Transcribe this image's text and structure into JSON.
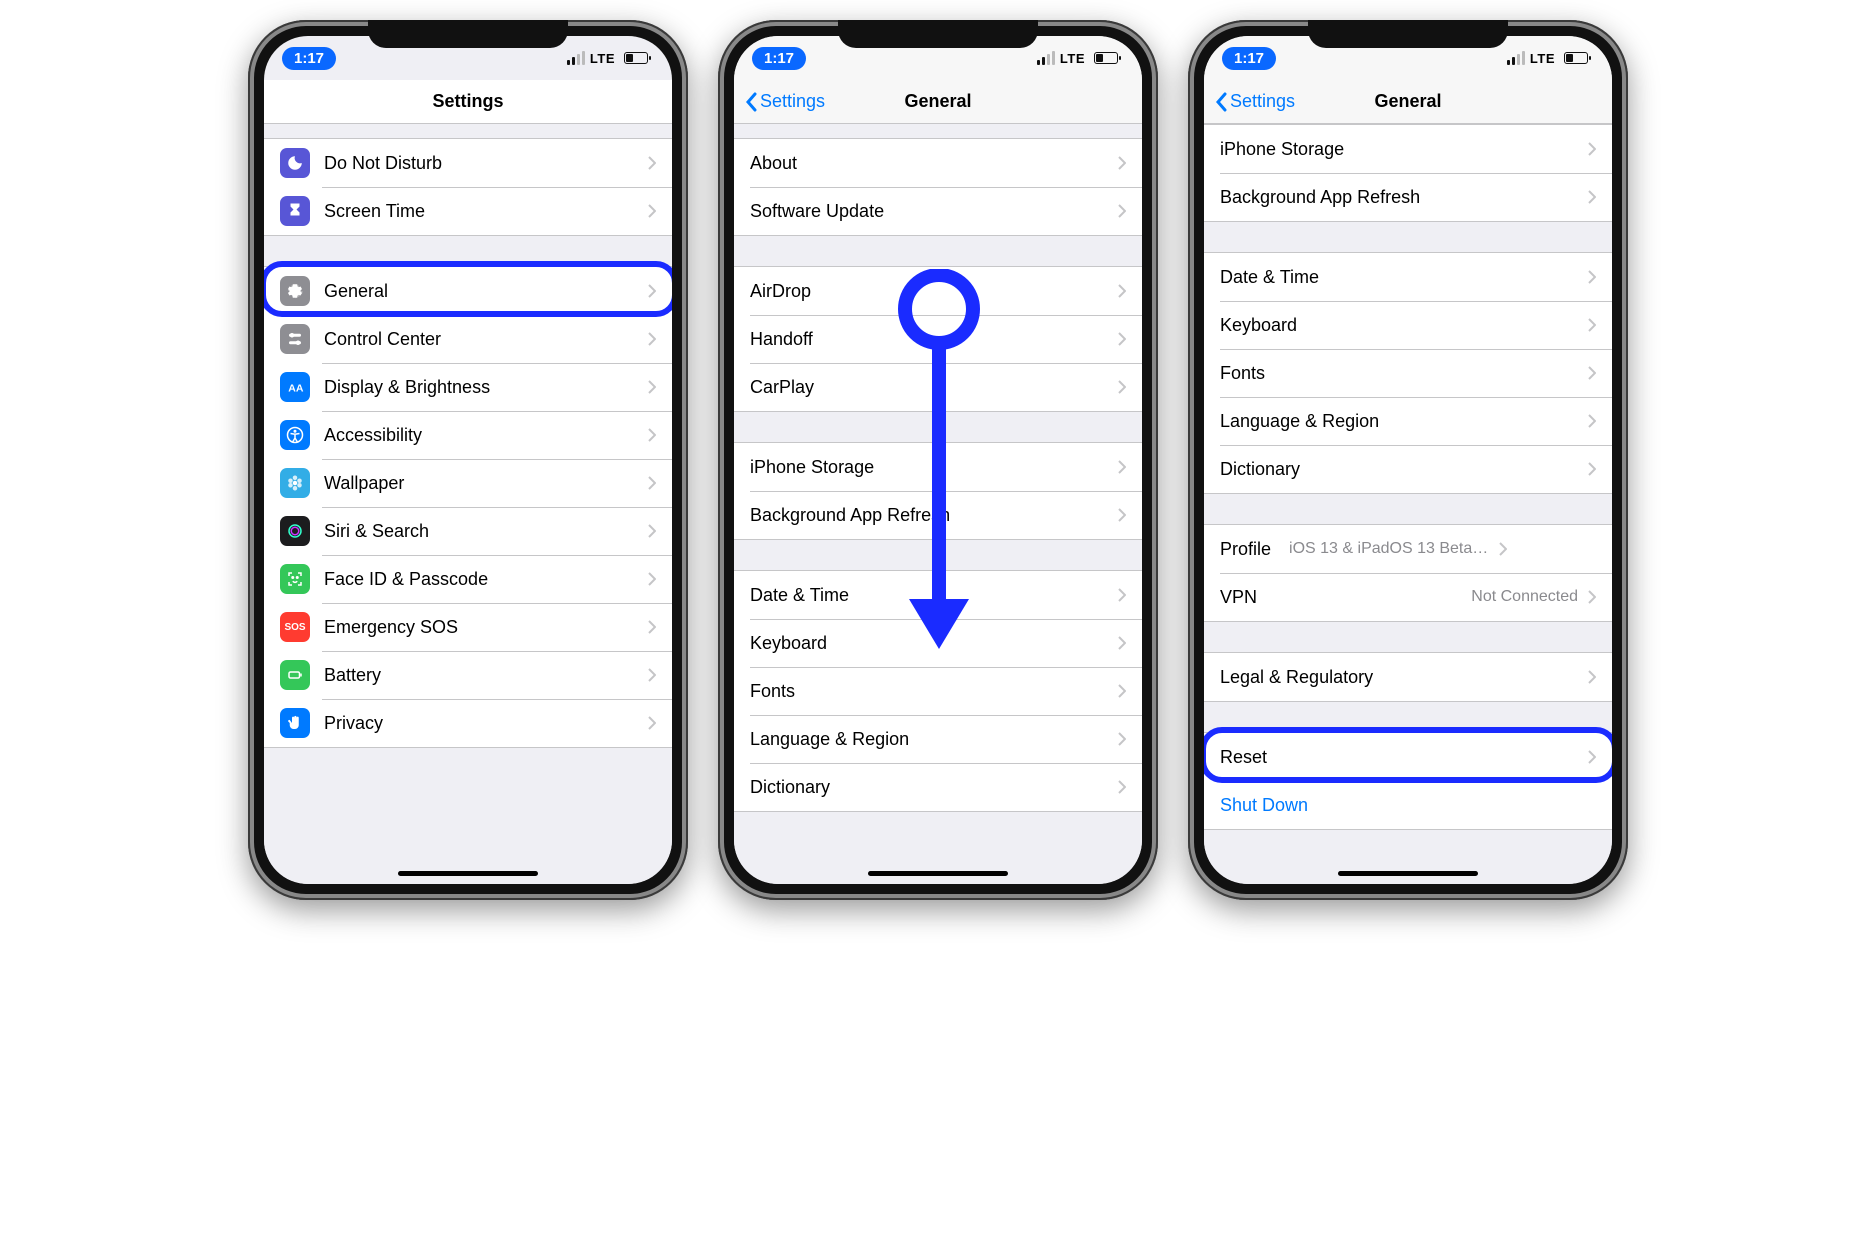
{
  "status": {
    "time": "1:17",
    "carrier": "LTE"
  },
  "phone1": {
    "title": "Settings",
    "group1": [
      {
        "name": "do-not-disturb",
        "label": "Do Not Disturb",
        "iconBg": "bg-purple"
      },
      {
        "name": "screen-time",
        "label": "Screen Time",
        "iconBg": "bg-purple"
      }
    ],
    "group2": [
      {
        "name": "general",
        "label": "General",
        "iconBg": "bg-grey",
        "highlight": true
      },
      {
        "name": "control-center",
        "label": "Control Center",
        "iconBg": "bg-grey"
      },
      {
        "name": "display-brightness",
        "label": "Display & Brightness",
        "iconBg": "bg-blue"
      },
      {
        "name": "accessibility",
        "label": "Accessibility",
        "iconBg": "bg-blue"
      },
      {
        "name": "wallpaper",
        "label": "Wallpaper",
        "iconBg": "bg-cyan"
      },
      {
        "name": "siri-search",
        "label": "Siri & Search",
        "iconBg": "bg-black"
      },
      {
        "name": "face-id-passcode",
        "label": "Face ID & Passcode",
        "iconBg": "bg-green"
      },
      {
        "name": "emergency-sos",
        "label": "Emergency SOS",
        "iconBg": "bg-red"
      },
      {
        "name": "battery",
        "label": "Battery",
        "iconBg": "bg-green"
      },
      {
        "name": "privacy",
        "label": "Privacy",
        "iconBg": "bg-blue"
      }
    ]
  },
  "phone2": {
    "back": "Settings",
    "title": "General",
    "group1": [
      {
        "label": "About"
      },
      {
        "label": "Software Update"
      }
    ],
    "group2": [
      {
        "label": "AirDrop"
      },
      {
        "label": "Handoff"
      },
      {
        "label": "CarPlay"
      }
    ],
    "group3": [
      {
        "label": "iPhone Storage"
      },
      {
        "label": "Background App Refresh"
      }
    ],
    "group4": [
      {
        "label": "Date & Time"
      },
      {
        "label": "Keyboard"
      },
      {
        "label": "Fonts"
      },
      {
        "label": "Language & Region"
      },
      {
        "label": "Dictionary"
      }
    ]
  },
  "phone3": {
    "back": "Settings",
    "title": "General",
    "group0": [
      {
        "label": "iPhone Storage"
      },
      {
        "label": "Background App Refresh"
      }
    ],
    "group1": [
      {
        "label": "Date & Time"
      },
      {
        "label": "Keyboard"
      },
      {
        "label": "Fonts"
      },
      {
        "label": "Language & Region"
      },
      {
        "label": "Dictionary"
      }
    ],
    "group2": [
      {
        "label": "Profile",
        "detail": "iOS 13 & iPadOS 13 Beta Softwar..."
      },
      {
        "label": "VPN",
        "detail": "Not Connected"
      }
    ],
    "group3": [
      {
        "label": "Legal & Regulatory"
      }
    ],
    "group4": [
      {
        "label": "Reset",
        "highlight": true
      },
      {
        "label": "Shut Down",
        "link": true,
        "nochev": true
      }
    ]
  }
}
